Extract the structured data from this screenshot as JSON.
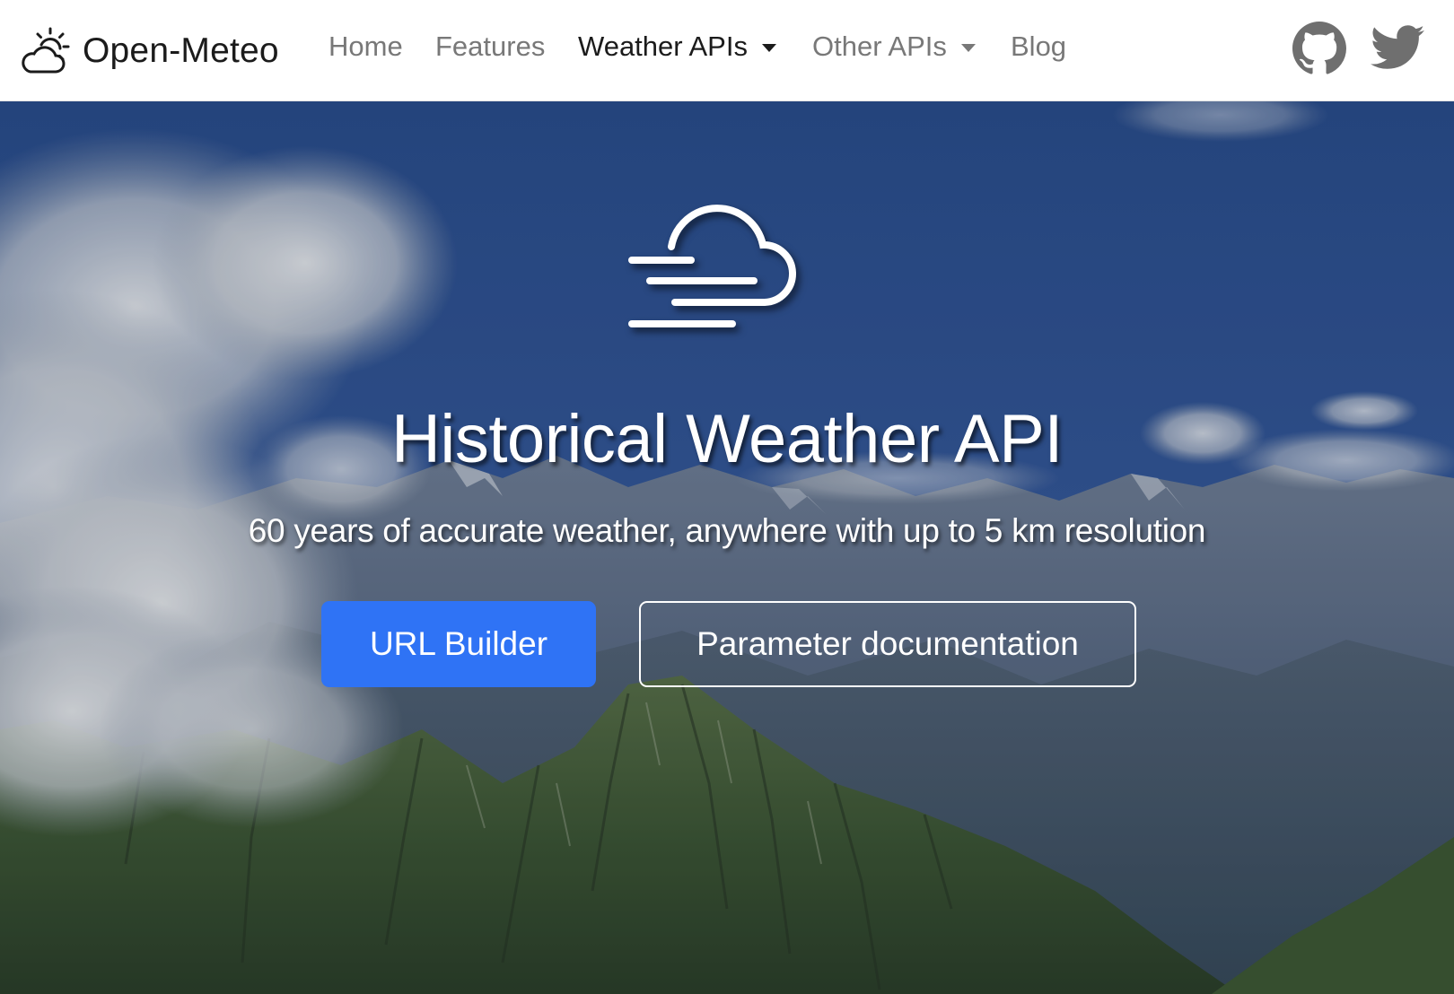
{
  "brand": {
    "name": "Open-Meteo",
    "icon": "cloud-sun-icon"
  },
  "nav": {
    "items": [
      {
        "label": "Home",
        "active": false,
        "dropdown": false
      },
      {
        "label": "Features",
        "active": false,
        "dropdown": false
      },
      {
        "label": "Weather APIs",
        "active": true,
        "dropdown": true
      },
      {
        "label": "Other APIs",
        "active": false,
        "dropdown": true
      },
      {
        "label": "Blog",
        "active": false,
        "dropdown": false
      }
    ],
    "social": [
      {
        "icon": "github-icon"
      },
      {
        "icon": "twitter-icon"
      }
    ]
  },
  "hero": {
    "icon": "fog-cloud-icon",
    "title": "Historical Weather API",
    "subtitle": "60 years of accurate weather, anywhere with up to 5 km resolution",
    "buttons": {
      "primary_label": "URL Builder",
      "secondary_label": "Parameter documentation"
    }
  },
  "colors": {
    "primary_button": "#2f73f5",
    "navbar_background": "#ffffff",
    "nav_text": "#787878",
    "nav_text_active": "#1b1b1b"
  }
}
